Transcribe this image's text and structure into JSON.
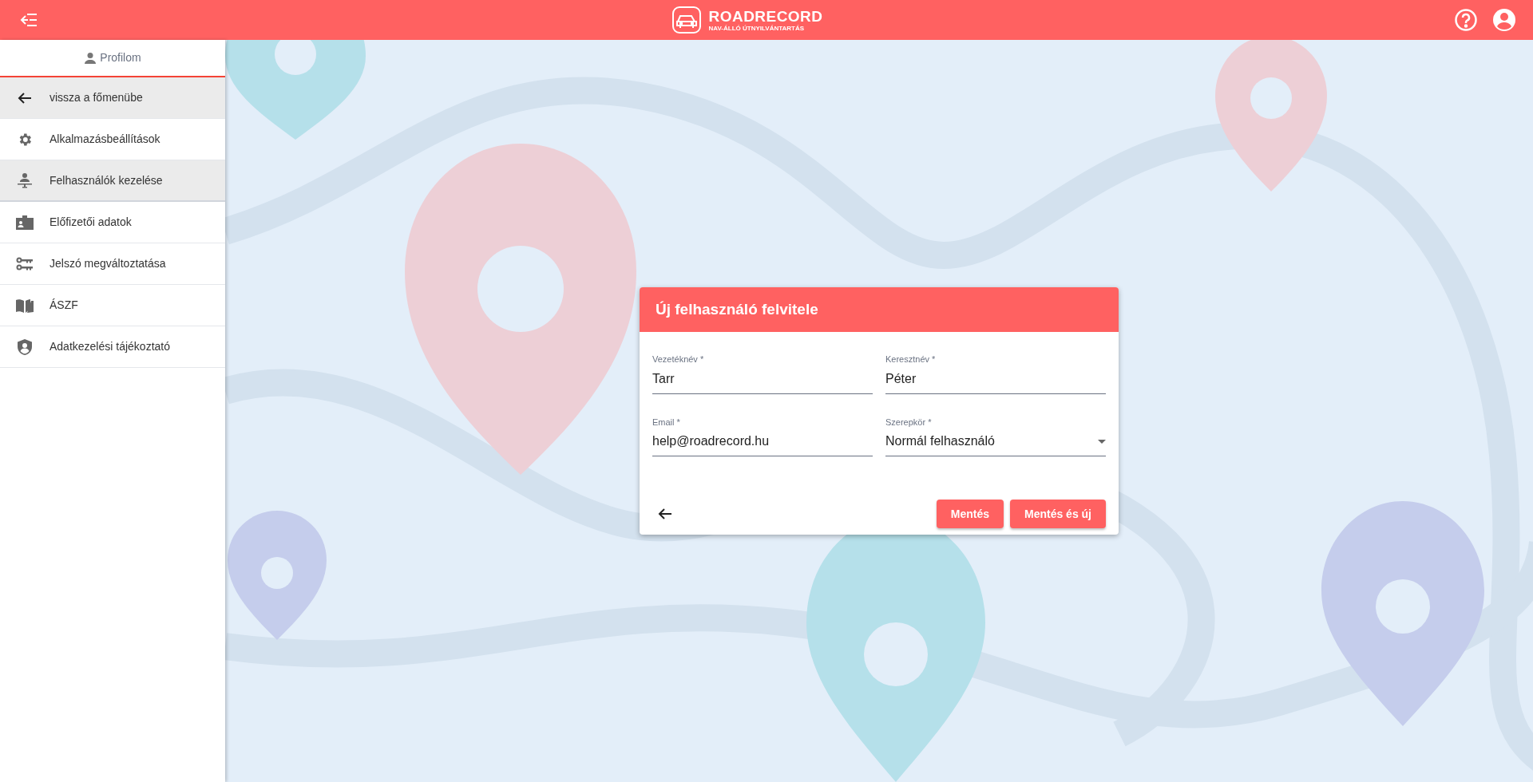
{
  "header": {
    "brand": "ROADRECORD",
    "tagline": "NAV-ÁLLÓ ÚTNYILVÁNTARTÁS"
  },
  "sidebar": {
    "tab": {
      "label": "Profilom",
      "selected": true
    },
    "items": [
      {
        "kind": "back",
        "label": "vissza a főmenübe",
        "selected": false
      },
      {
        "kind": "link",
        "label": "Alkalmazásbeállítások",
        "selected": false
      },
      {
        "kind": "link",
        "label": "Felhasználók kezelése",
        "selected": true
      },
      {
        "kind": "link",
        "label": "Előfizetői adatok",
        "selected": false
      },
      {
        "kind": "link",
        "label": "Jelszó megváltoztatása",
        "selected": false
      },
      {
        "kind": "link",
        "label": "ÁSZF",
        "selected": false
      },
      {
        "kind": "link",
        "label": "Adatkezelési tájékoztató",
        "selected": false
      }
    ]
  },
  "dialog": {
    "title": "Új felhasználó felvitele",
    "fields": [
      {
        "kind": "text",
        "label": "Vezetéknév *",
        "value": "Tarr"
      },
      {
        "kind": "text",
        "label": "Keresztnév *",
        "value": "Péter"
      },
      {
        "kind": "text",
        "label": "Email *",
        "value": "help@roadrecord.hu"
      },
      {
        "kind": "select",
        "label": "Szerepkör *",
        "value": "Normál felhasználó"
      }
    ],
    "buttons": [
      "Mentés",
      "Mentés és új"
    ]
  }
}
